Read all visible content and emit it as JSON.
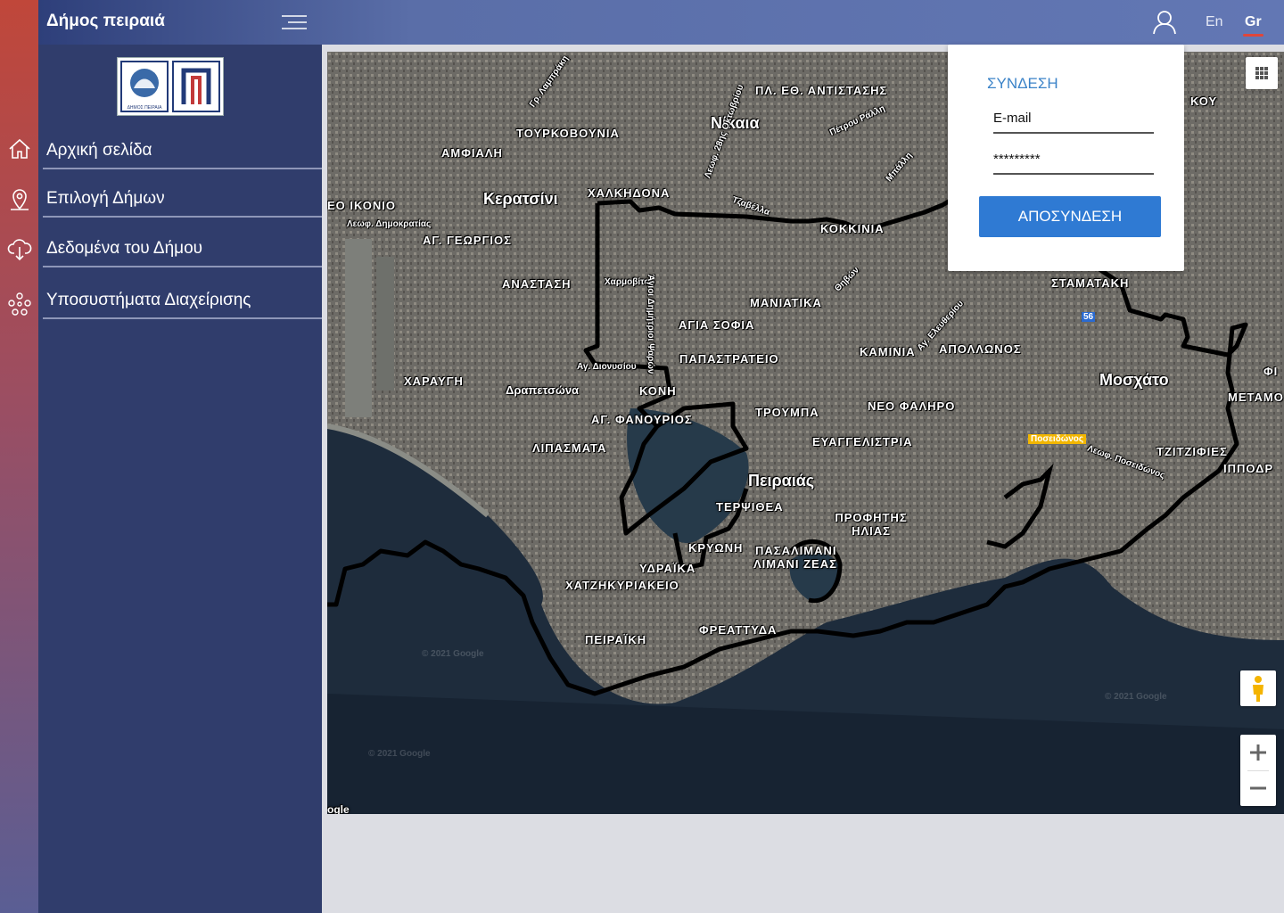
{
  "header": {
    "brand": "Δήμος πειραιά",
    "lang_en": "En",
    "lang_gr": "Gr"
  },
  "sidebar": {
    "items": [
      {
        "label": "Αρχική σελίδα",
        "icon": "home-icon"
      },
      {
        "label": "Επιλογή Δήμων",
        "icon": "map-pin-icon"
      },
      {
        "label": "Δεδομένα του Δήμου",
        "icon": "cloud-download-icon"
      },
      {
        "label": "Υποσυστήματα Διαχείρισης",
        "icon": "network-icon"
      }
    ]
  },
  "login": {
    "title": "ΣΥΝΔΕΣΗ",
    "email_value": "E-mail",
    "password_value": "*********",
    "logout_label": "ΑΠΟΣΥΝΔΕΣΗ"
  },
  "map": {
    "labels": [
      "ΠΛ. ΕΘ. ΑΝΤΙΣΤΑΣΗΣ",
      "Νίκαια",
      "ΤΟΥΡΚΟΒΟΥΝΙΑ",
      "ΑΜΦΙΑΛΗ",
      "Κερατσίνι",
      "ΧΑΛΚΗΔΟΝΑ",
      "ΚΟΚΚΙΝΙΑ",
      "ΑΓ. ΓΕΩΡΓΙΟΣ",
      "ΑΝΑΣΤΑΣΗ",
      "ΜΑΝΙΑΤΙΚΑ",
      "ΑΓΙΑ ΣΟΦΙΑ",
      "ΚΑΜΙΝΙΑ",
      "ΑΠΟΛΛΩΝΟΣ",
      "ΣΤΑΜΑΤΑΚΗ",
      "ΠΑΠΑΣΤΡΑΤΕΙΟ",
      "ΧΑΡΑΥΓΗ",
      "Δραπετσώνα",
      "ΚΟΝΗ",
      "Μοσχάτο",
      "ΤΡΟΥΜΠΑ",
      "ΝΕΟ ΦΑΛΗΡΟ",
      "ΑΓ. ΦΑΝΟΥΡΙΟΣ",
      "ΛΙΠΑΣΜΑΤΑ",
      "ΕΥΑΓΓΕΛΙΣΤΡΙΑ",
      "ΤΖΙΤΖΙΦΙΕΣ",
      "Πειραιάς",
      "ΤΕΡΨΙΘΕΑ",
      "ΠΡΟΦΗΤΗΣ ΗΛΙΑΣ",
      "ΚΡΥΩΝΗ",
      "ΠΑΣΑΛΙΜΑΝΙ",
      "ΛΙΜΑΝΙ ΖΕΑΣ",
      "ΥΔΡΑΪΚΑ",
      "ΧΑΤΖΗΚΥΡΙΑΚΕΙΟ",
      "ΦΡΕΑΤΤΥΔΑ",
      "ΠΕΙΡΑΪΚΗ",
      "ΕΟ ΙΚΟΝΙΟ",
      "ΜΕΤΑΜΟ",
      "ΙΠΠΟΔΡ",
      "ΦΙ",
      "ΚΟΥ",
      "Χαρμοβίτου",
      "Άγιοι Δημήτριοι Ψαρών",
      "Λεωφ. Δημοκρατίας",
      "Τζαβέλλα",
      "Θηβών",
      "Λεωφ. Ποσειδώνος",
      "Ποσειδώνος",
      "Αγ. Ελευθερίου",
      "Γρ. Λαμπράκη",
      "Πέτρου Ράλλη",
      "Λεωφ. 28ης Οκτωβρίου",
      "Μπάλλη",
      "56",
      "Αγ. Διονυσίου"
    ],
    "watermarks": [
      "© 2021 Google",
      "© 2021 Google",
      "© 2021 Google"
    ],
    "footer_fragment": "ogle"
  }
}
